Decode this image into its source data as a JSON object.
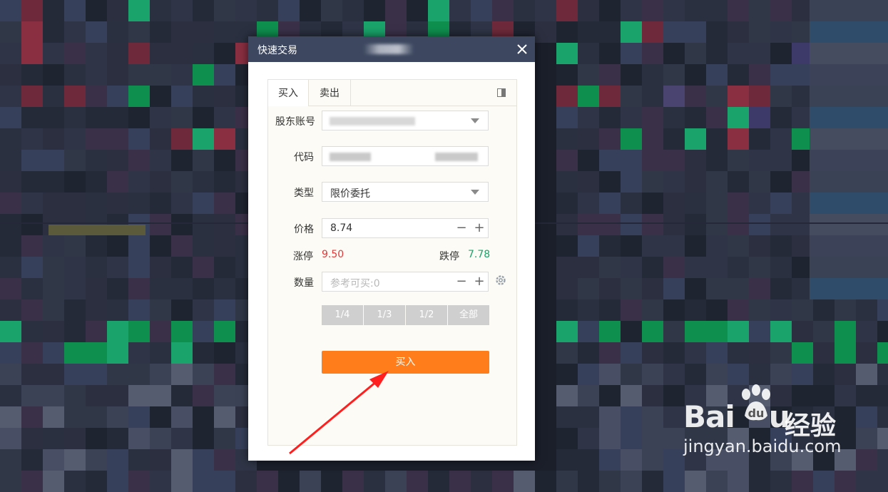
{
  "dialog": {
    "title": "快速交易",
    "tabs": [
      "买入",
      "卖出"
    ],
    "form": {
      "account_label": "股东账号",
      "code_label": "代码",
      "type_label": "类型",
      "type_value": "限价委托",
      "price_label": "价格",
      "price_value": "8.74",
      "limit_up_label": "涨停",
      "limit_up_value": "9.50",
      "limit_down_label": "跌停",
      "limit_down_value": "7.78",
      "quantity_label": "数量",
      "quantity_placeholder": "参考可买:0",
      "fractions": [
        "1/4",
        "1/3",
        "1/2",
        "全部"
      ],
      "submit_label": "买入"
    }
  },
  "stepper": {
    "minus": "−",
    "plus": "+"
  },
  "watermark": {
    "logo": "Bai",
    "logo_suffix": "u",
    "cn": "经验",
    "url": "jingyan.baidu.com"
  },
  "colors": {
    "title_bar": "#3d4860",
    "buy_button": "#ff7e1b",
    "limit_up": "#e03a3a",
    "limit_down": "#1aa36a",
    "arrow": "#ff1f1f"
  },
  "icons": {
    "close": "close-icon",
    "panel_toggle": "panel-toggle-icon",
    "dropdown": "chevron-down-icon",
    "settings": "gear-icon"
  }
}
